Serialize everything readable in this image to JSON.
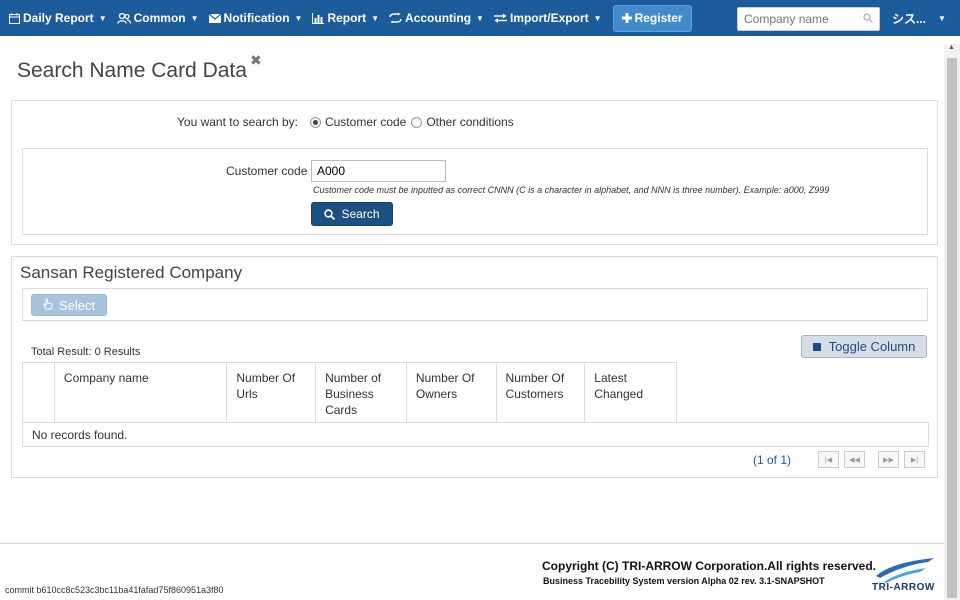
{
  "nav": {
    "items": [
      {
        "label": "Daily Report",
        "icon": "calendar-icon"
      },
      {
        "label": "Common",
        "icon": "users-icon"
      },
      {
        "label": "Notification",
        "icon": "envelope-icon"
      },
      {
        "label": "Report",
        "icon": "bar-chart-icon"
      },
      {
        "label": "Accounting",
        "icon": "exchange-icon"
      },
      {
        "label": "Import/Export",
        "icon": "transfer-icon"
      }
    ],
    "register_label": "Register",
    "search_placeholder": "Company name",
    "user_label": "シス..."
  },
  "page": {
    "title": "Search Name Card Data",
    "close_glyph": "✖"
  },
  "search": {
    "by_label": "You want to search by:",
    "options": [
      {
        "label": "Customer code",
        "checked": true
      },
      {
        "label": "Other conditions",
        "checked": false
      }
    ],
    "customer_code_label": "Customer code",
    "customer_code_value": "A000",
    "hint": "Customer code must be inputted as correct CNNN (C is a character in alphabet, and NNN is three number). Example: a000, Z999",
    "button_label": "Search"
  },
  "results": {
    "title": "Sansan Registered Company",
    "select_label": "Select",
    "toggle_label": "Toggle Column",
    "total": "Total Result: 0 Results",
    "columns": [
      "",
      "Company name",
      "Number Of Urls",
      "Number of Business Cards",
      "Number Of Owners",
      "Number Of Customers",
      "Latest Changed"
    ],
    "empty_message": "No records found.",
    "pager_info": "(1 of 1)",
    "pager_buttons": [
      "|◀",
      "◀◀",
      "▶▶",
      "▶|"
    ]
  },
  "footer": {
    "copyright": "Copyright (C) TRI-ARROW Corporation.All rights reserved.",
    "version": "Business Tracebility System version Alpha 02 rev. 3.1-SNAPSHOT",
    "commit": "commit b610cc8c523c3bc11ba41fafad75f860951a3f80",
    "logo_text": "TRI-ARROW"
  },
  "colors": {
    "navbar": "#1c5c9a",
    "primary_button": "#1c4f82",
    "link": "#1f5aa6"
  }
}
